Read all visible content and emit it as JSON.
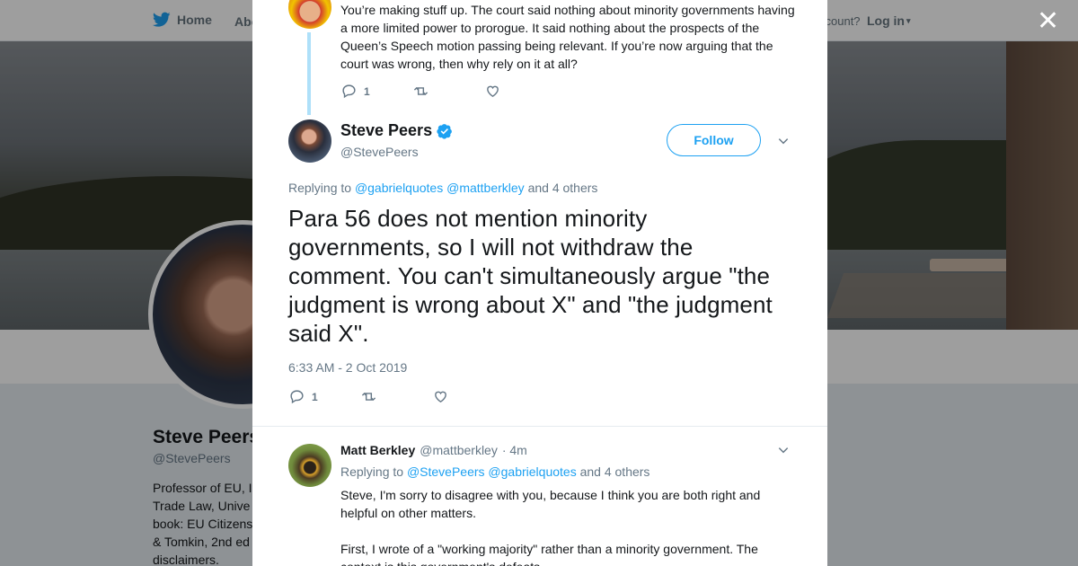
{
  "topbar": {
    "home_label": "Home",
    "about_label": "Abo",
    "account_prompt": "ccount?",
    "login_label": "Log in"
  },
  "profile": {
    "name": "Steve Peers",
    "handle": "@StevePeers",
    "bio": "Professor of EU, I\nTrade Law, Unive\nbook: EU Citizens\n& Tomkin, 2nd ed\ndisclaimers."
  },
  "modal": {
    "previous_tweet": {
      "text": "You’re making stuff up. The court said nothing about minority governments having a more limited power to prorogue. It said nothing about the prospects of the Queen’s Speech motion passing being relevant. If you’re now arguing that the court was wrong, then why rely on it at all?",
      "reply_count": "1"
    },
    "main_tweet": {
      "author_name": "Steve Peers",
      "author_handle": "@StevePeers",
      "follow_label": "Follow",
      "replying_prefix": "Replying to",
      "mentions": [
        "@gabrielquotes",
        "@mattberkley"
      ],
      "others": "and 4 others",
      "text": "Para 56 does not mention minority governments, so I will not withdraw the comment. You can't simultaneously argue \"the judgment is wrong about X\" and \"the judgment said X\".",
      "timestamp": "6:33 AM - 2 Oct 2019",
      "reply_count": "1"
    },
    "reply_tweet": {
      "author_name": "Matt Berkley",
      "author_handle": "@mattberkley",
      "time": "· 4m",
      "replying_prefix": "Replying to",
      "mentions": [
        "@StevePeers",
        "@gabrielquotes"
      ],
      "others": "and 4 others",
      "text": "Steve, I'm sorry to disagree with you, because I think you are both right and helpful on other matters.\n\nFirst, I wrote of a \"working majority\" rather than a minority government.  The\ncontext is this government's defeats."
    }
  },
  "colors": {
    "accent": "#1da1f2",
    "text": "#14171a",
    "secondary": "#657786",
    "thread_line": "#aee0f9"
  },
  "icons": [
    "twitter-bird-icon",
    "close-icon",
    "reply-icon",
    "retweet-icon",
    "like-icon",
    "verified-icon",
    "chevron-down-icon"
  ]
}
